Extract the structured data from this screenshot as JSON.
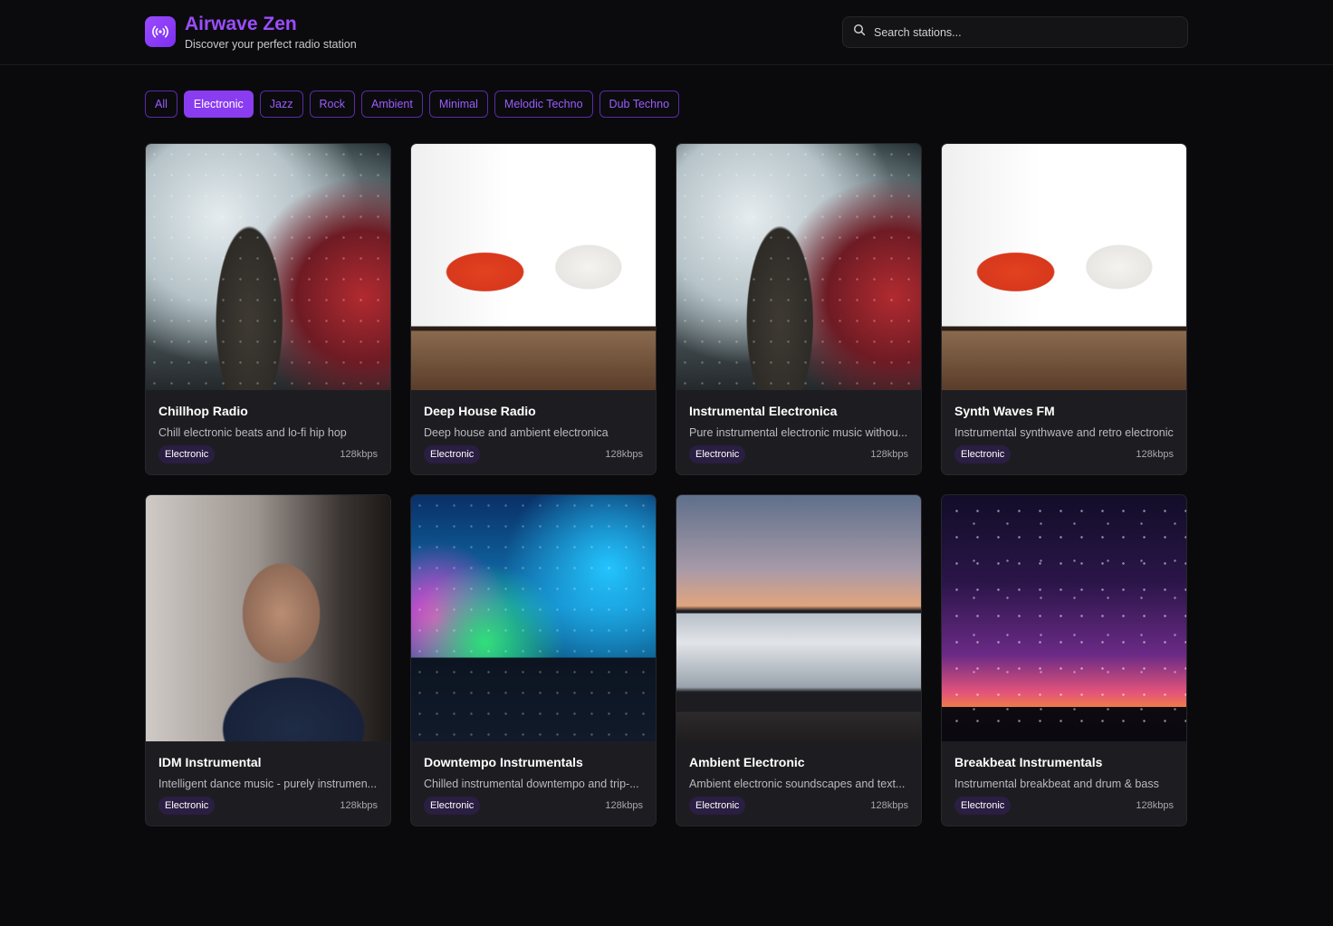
{
  "header": {
    "title": "Airwave Zen",
    "subtitle": "Discover your perfect radio station",
    "logo_icon": "radio-broadcast-icon",
    "accent_color": "#9b4dff"
  },
  "search": {
    "placeholder": "Search stations...",
    "icon": "search-icon"
  },
  "filters": {
    "active": "Electronic",
    "items": [
      "All",
      "Electronic",
      "Jazz",
      "Rock",
      "Ambient",
      "Minimal",
      "Melodic Techno",
      "Dub Techno"
    ]
  },
  "stations": [
    {
      "name": "Chillhop Radio",
      "description": "Chill electronic beats and lo-fi hip hop",
      "genre": "Electronic",
      "bitrate": "128kbps",
      "image": "smoke-performer"
    },
    {
      "name": "Deep House Radio",
      "description": "Deep house and ambient electronica",
      "genre": "Electronic",
      "bitrate": "128kbps",
      "image": "yoga-situp"
    },
    {
      "name": "Instrumental Electronica",
      "description": "Pure instrumental electronic music withou...",
      "genre": "Electronic",
      "bitrate": "128kbps",
      "image": "smoke-performer"
    },
    {
      "name": "Synth Waves FM",
      "description": "Instrumental synthwave and retro electronic",
      "genre": "Electronic",
      "bitrate": "128kbps",
      "image": "yoga-situp"
    },
    {
      "name": "IDM Instrumental",
      "description": "Intelligent dance music - purely instrumen...",
      "genre": "Electronic",
      "bitrate": "128kbps",
      "image": "craftsman-tools"
    },
    {
      "name": "Downtempo Instrumentals",
      "description": "Chilled instrumental downtempo and trip-...",
      "genre": "Electronic",
      "bitrate": "128kbps",
      "image": "concert-crowd"
    },
    {
      "name": "Ambient Electronic",
      "description": "Ambient electronic soundscapes and text...",
      "genre": "Electronic",
      "bitrate": "128kbps",
      "image": "mountain-clouds"
    },
    {
      "name": "Breakbeat Instrumentals",
      "description": "Instrumental breakbeat and drum & bass",
      "genre": "Electronic",
      "bitrate": "128kbps",
      "image": "starry-sky"
    }
  ]
}
